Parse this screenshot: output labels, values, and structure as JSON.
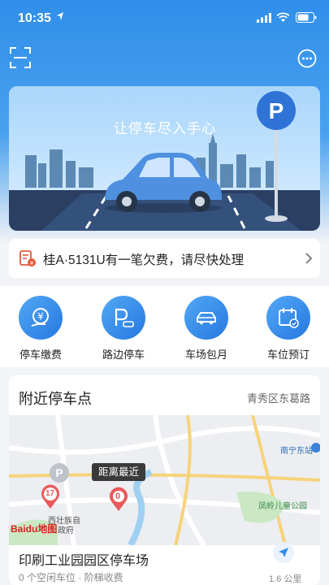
{
  "status_bar": {
    "time": "10:35"
  },
  "banner": {
    "title": "让停车尽入手心"
  },
  "notice": {
    "text": "桂A·5131U有一笔欠费，请尽快处理"
  },
  "services": [
    {
      "label": "停车缴费",
      "icon": "yen-payment-icon"
    },
    {
      "label": "路边停车",
      "icon": "roadside-parking-icon"
    },
    {
      "label": "车场包月",
      "icon": "car-icon"
    },
    {
      "label": "车位预订",
      "icon": "calendar-check-icon"
    }
  ],
  "nearby": {
    "title": "附近停车点",
    "area": "青秀区东葛路",
    "map": {
      "tooltip": "距离最近",
      "markers": [
        "0",
        "17"
      ],
      "labels": [
        "南宁东站",
        "凤岭儿童公园",
        "西壮族自",
        "政府"
      ],
      "logo": "Baidu地图"
    },
    "lot": {
      "name": "印刷工业园园区停车场",
      "info": "0 个空闲车位 · 阶梯收费",
      "distance": "1.6 公里"
    }
  },
  "colors": {
    "primary": "#2f8fe9",
    "alert": "#e45a3c"
  }
}
